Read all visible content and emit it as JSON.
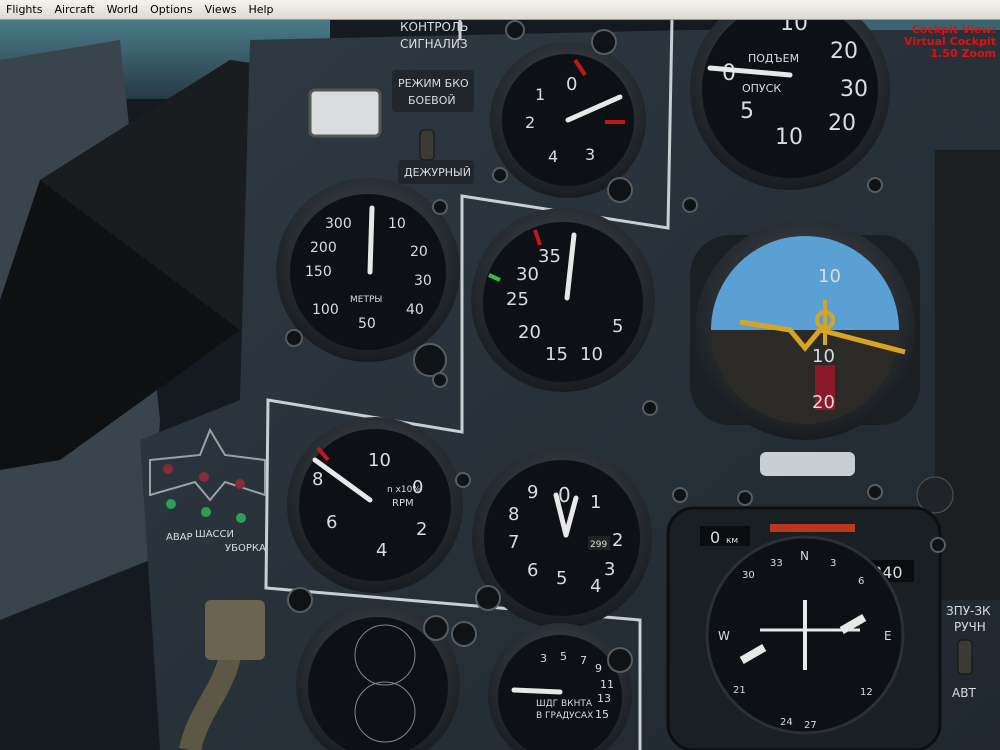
{
  "menu": {
    "items": [
      "Flights",
      "Aircraft",
      "World",
      "Options",
      "Views",
      "Help"
    ]
  },
  "view_info": {
    "line1": "Cockpit View:",
    "line2": "Virtual Cockpit",
    "line3": "1.50 Zoom"
  },
  "labels": {
    "kontrol": "КОНТРОЛЬ",
    "signaliz": "СИГНАЛИЗ",
    "rezhim": "РЕЖИМ БКО",
    "boevoy": "БОЕВОЙ",
    "dezhurny": "ДЕЖУРНЫЙ",
    "avar": "АВАР",
    "shassi": "ШАССИ",
    "uborka": "УБОРКА",
    "zpu": "ЗПУ-ЗК",
    "ruchn": "РУЧН",
    "avt": "АВТ"
  },
  "gauges": {
    "altimeter": {
      "ticks": [
        "300",
        "10",
        "200",
        "20",
        "150",
        "30",
        "100",
        "40",
        "50"
      ],
      "unit": "МЕТРЫ"
    },
    "airspeed": {
      "ticks": [
        "35",
        "30",
        "25",
        "20",
        "15",
        "10",
        "5"
      ]
    },
    "rpm": {
      "ticks": [
        "10",
        "8",
        "0",
        "6",
        "2",
        "4"
      ],
      "unit_top": "n x10%",
      "unit": "RPM"
    },
    "clock": {
      "ticks": [
        "0",
        "1",
        "2",
        "3",
        "4",
        "5",
        "6",
        "7",
        "8",
        "9"
      ],
      "counter": "299"
    },
    "vsi": {
      "ticks": [
        "10",
        "20",
        "0",
        "30",
        "5",
        "20",
        "10",
        "20"
      ],
      "up": "ПОДЪЕМ",
      "down": "ОПУСК"
    },
    "g_meter": {
      "ticks": [
        "0",
        "1",
        "2",
        "3",
        "4"
      ]
    },
    "attitude": {
      "ticks": [
        "10",
        "10",
        "20"
      ]
    },
    "hsi": {
      "distance": "0",
      "distance_unit": "км",
      "heading": "340",
      "ticks": [
        "30",
        "33",
        "N",
        "3",
        "6",
        "W",
        "21",
        "24",
        "27",
        "E",
        "12"
      ]
    },
    "flap": {
      "title1": "ШДГ ВКНТА",
      "title2": "В ГРАДУСАХ",
      "ticks": [
        "3",
        "5",
        "7",
        "9",
        "11",
        "13",
        "15"
      ]
    }
  },
  "colors": {
    "panel": "#2a333b",
    "gauge_face": "#0d1014",
    "needle": "#e8e8e8",
    "warning_red": "#c01818",
    "sky": "#5aa0d4",
    "ground": "#2b2a26",
    "attitude_bar": "#d9a520"
  }
}
